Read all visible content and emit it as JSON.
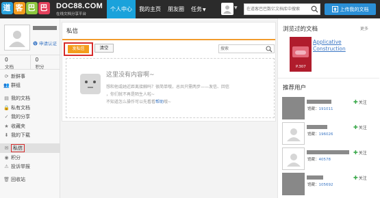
{
  "header": {
    "logo_text": "道客巴巴",
    "brand_name": "DOC88.COM",
    "brand_sub": "在线文档分享平台",
    "nav": [
      {
        "label": "个人中心",
        "active": true
      },
      {
        "label": "我的主页",
        "active": false
      },
      {
        "label": "朋友圈",
        "active": false
      },
      {
        "label": "任务",
        "active": false
      }
    ],
    "search_placeholder": "在道客巴巴数亿文档库中搜索",
    "upload_label": "上传我的文档"
  },
  "sidebar": {
    "verify_label": "申请认证",
    "stats": [
      {
        "value": "0",
        "label": "文档"
      },
      {
        "value": "0",
        "label": "积分"
      }
    ],
    "menu": [
      {
        "label": "新鲜事",
        "icon": "refresh-icon"
      },
      {
        "label": "群组",
        "icon": "group-icon"
      },
      {
        "label": "我的文档",
        "icon": "document-icon"
      },
      {
        "label": "私有文档",
        "icon": "lock-icon"
      },
      {
        "label": "我的分享",
        "icon": "share-icon"
      },
      {
        "label": "收藏夹",
        "icon": "star-icon"
      },
      {
        "label": "我的下载",
        "icon": "download-icon"
      },
      {
        "label": "私信",
        "icon": "mail-icon",
        "active": true
      },
      {
        "label": "积分",
        "icon": "coin-icon"
      },
      {
        "label": "投诉举报",
        "icon": "warning-icon"
      },
      {
        "label": "回收站",
        "icon": "trash-icon"
      }
    ]
  },
  "main": {
    "title": "私信",
    "send_label": "发私信",
    "clear_label": "清空",
    "search_placeholder": "搜索",
    "empty_title": "这里没有内容啊~",
    "empty_line1": "想和他或她近距离接触吗？很简单哦，总共只需两步——发信、回信",
    "empty_line2": "，你们就不再是陌生人啦~",
    "empty_line3_prefix": "不知道怎么操作可以先看看",
    "empty_help": "帮助",
    "empty_line3_suffix": "哦~"
  },
  "right": {
    "viewed_title": "浏览过的文档",
    "more_label": "更多",
    "doc_title": "Applicative Construction",
    "doc_pages": "P.307",
    "recommend_title": "推荐用户",
    "stat_label": "馆藏：",
    "follow_label": "关注",
    "users": [
      {
        "count": "191011",
        "avatar": "photo"
      },
      {
        "count": "196026",
        "avatar": "default"
      },
      {
        "count": "40578",
        "avatar": "default"
      },
      {
        "count": "105692",
        "avatar": "photo"
      }
    ]
  }
}
